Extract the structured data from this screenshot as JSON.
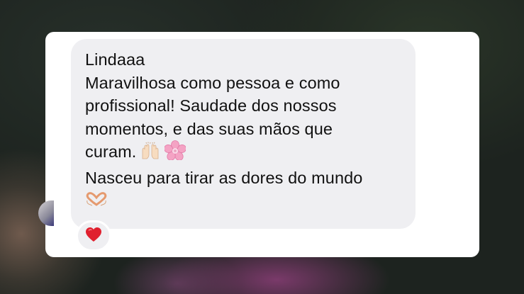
{
  "message": {
    "lines": [
      "Lindaaa",
      "Maravilhosa como pessoa e como",
      "profissional! Saudade dos nossos",
      "momentos, e das suas mãos que",
      "curam.",
      "Nasceu para tirar as dores do mundo"
    ],
    "line5_emojis": [
      "raising-hands-emoji",
      "cherry-blossom-emoji"
    ],
    "line7_emoji": "heart-hands-emoji"
  },
  "reaction": {
    "icon": "red-heart-icon",
    "color": "#e0202e"
  },
  "colors": {
    "card": "#ffffff",
    "bubble": "#efeff2",
    "text": "#111111"
  }
}
